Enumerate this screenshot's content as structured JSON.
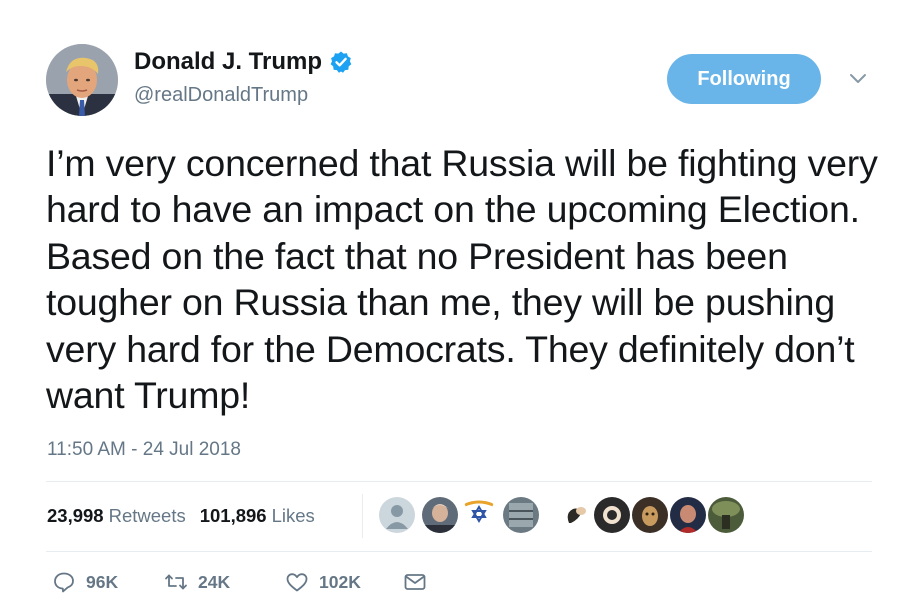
{
  "author": {
    "display_name": "Donald J. Trump",
    "handle": "@realDonaldTrump",
    "verified": true,
    "avatar_icon": "profile-photo"
  },
  "follow_button": {
    "label": "Following"
  },
  "tweet": {
    "text": "I’m very concerned that Russia will be fighting very hard to have an impact on the upcoming Election. Based on the fact that no President has been tougher on Russia than me, they will be pushing very hard for the Democrats. They definitely don’t want Trump!",
    "timestamp": "11:50 AM - 24 Jul 2018"
  },
  "stats": {
    "retweets_count": "23,998",
    "retweets_label": "Retweets",
    "likes_count": "101,896",
    "likes_label": "Likes"
  },
  "likers": [
    {
      "icon": "default-avatar"
    },
    {
      "icon": "profile-photo"
    },
    {
      "icon": "star-of-david-logo"
    },
    {
      "icon": "profile-photo"
    },
    {
      "icon": "profile-photo"
    },
    {
      "icon": "profile-photo"
    },
    {
      "icon": "profile-photo"
    },
    {
      "icon": "profile-photo"
    },
    {
      "icon": "profile-photo"
    }
  ],
  "actions": {
    "replies": "96K",
    "retweets": "24K",
    "likes": "102K"
  },
  "colors": {
    "accent": "#69b4e8",
    "verified": "#1da1f2",
    "secondary_text": "#657786"
  }
}
